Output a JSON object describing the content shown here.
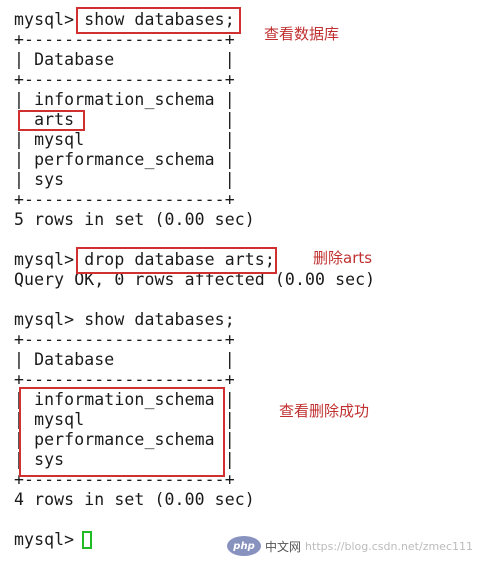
{
  "terminal": {
    "lines": [
      "mysql> show databases;",
      "+--------------------+",
      "| Database           |",
      "+--------------------+",
      "| information_schema |",
      "| arts               |",
      "| mysql              |",
      "| performance_schema |",
      "| sys                |",
      "+--------------------+",
      "5 rows in set (0.00 sec)",
      "",
      "mysql> drop database arts;",
      "Query OK, 0 rows affected (0.00 sec)",
      "",
      "mysql> show databases;",
      "+--------------------+",
      "| Database           |",
      "+--------------------+",
      "| information_schema |",
      "| mysql              |",
      "| performance_schema |",
      "| sys                |",
      "+--------------------+",
      "4 rows in set (0.00 sec)",
      "",
      "mysql> "
    ]
  },
  "annotations": {
    "view_databases": "查看数据库",
    "delete_arts": "删除arts",
    "view_delete_success": "查看删除成功"
  },
  "watermark": {
    "site_name": "中文网",
    "logo_text": "php",
    "url": "https://blog.csdn.net/zmec111"
  },
  "colors": {
    "highlight_box": "#d03030",
    "annotation_text": "#c03030",
    "cursor": "#22bb22"
  }
}
